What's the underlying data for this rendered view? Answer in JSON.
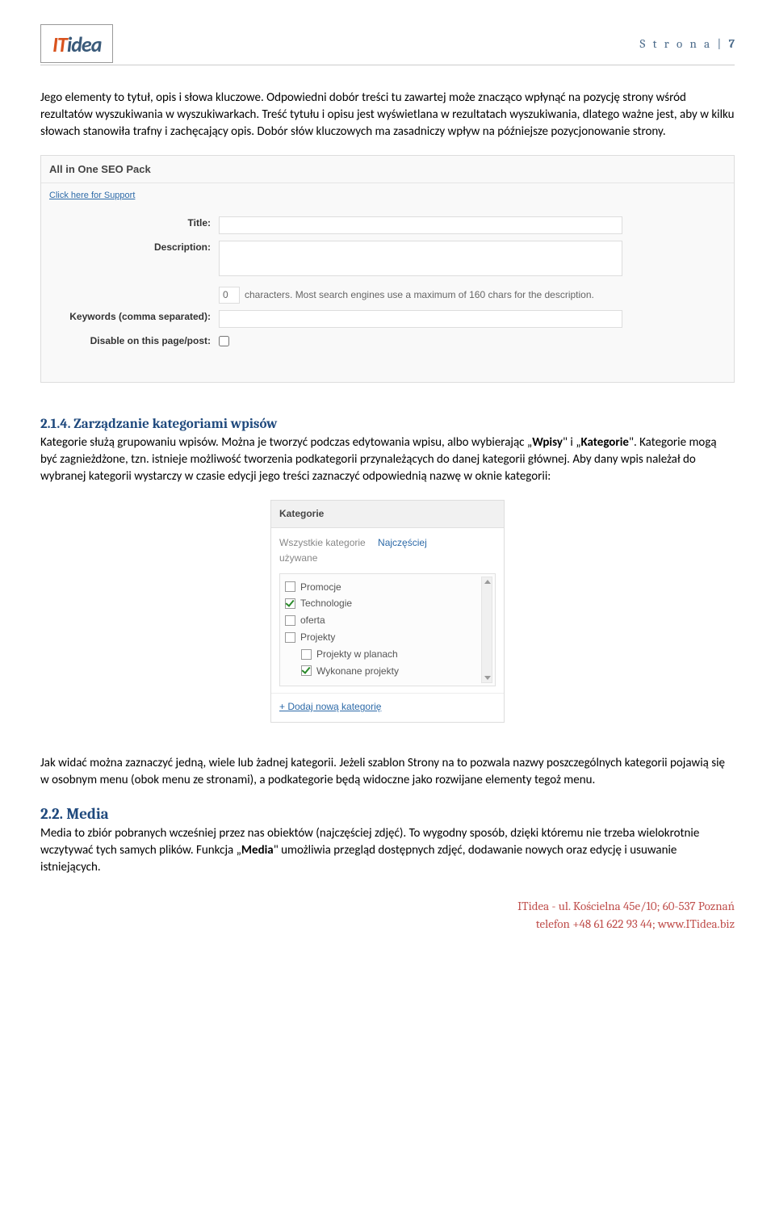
{
  "header": {
    "logo_it": "IT",
    "logo_idea": "idea",
    "page_label": "S t r o n a  | ",
    "page_no": "7"
  },
  "para1": "Jego elementy to tytuł, opis i słowa kluczowe. Odpowiedni dobór treści tu zawartej może znacząco wpłynąć na pozycję strony wśród rezultatów wyszukiwania w wyszukiwarkach. Treść tytułu i opisu jest wyświetlana w rezultatach wyszukiwania, dlatego ważne jest, aby w kilku słowach stanowiła trafny i zachęcający opis. Dobór słów kluczowych ma zasadniczy wpływ na późniejsze pozycjonowanie strony.",
  "seo": {
    "panel_title": "All in One SEO Pack",
    "support_link": "Click here for Support",
    "title_label": "Title:",
    "desc_label": "Description:",
    "char_count": "0",
    "char_hint": "characters. Most search engines use a maximum of 160 chars for the description.",
    "keywords_label": "Keywords (comma separated):",
    "disable_label": "Disable on this page/post:"
  },
  "h214_no": "2.1.4. ",
  "h214_title": "Zarządzanie kategoriami wpisów",
  "para2a": "Kategorie służą grupowaniu wpisów. Można je tworzyć podczas edytowania wpisu, albo wybierając „",
  "para2_wpisy": "Wpisy",
  "para2b": "\" i „",
  "para2_kategorie": "Kategorie",
  "para2c": "\". Kategorie mogą być zagnieżdżone, tzn. istnieje możliwość tworzenia podkategorii przynależących do danej kategorii głównej. Aby dany wpis należał do wybranej kategorii wystarczy w czasie edycji jego treści zaznaczyć odpowiednią nazwę w oknie kategorii:",
  "categories": {
    "panel_title": "Kategorie",
    "tab_all": "Wszystkie kategorie",
    "tab_freq": "Najczęściej",
    "tab_freq2": "używane",
    "items": [
      {
        "label": "Promocje",
        "checked": false,
        "indent": false
      },
      {
        "label": "Technologie",
        "checked": true,
        "indent": false
      },
      {
        "label": "oferta",
        "checked": false,
        "indent": false
      },
      {
        "label": "Projekty",
        "checked": false,
        "indent": false
      },
      {
        "label": "Projekty w planach",
        "checked": false,
        "indent": true
      },
      {
        "label": "Wykonane projekty",
        "checked": true,
        "indent": true
      }
    ],
    "add_link": "+ Dodaj nową kategorię"
  },
  "para3": "Jak widać można zaznaczyć jedną, wiele lub żadnej kategorii. Jeżeli szablon Strony na to pozwala nazwy poszczególnych kategorii pojawią się w osobnym menu (obok menu ze stronami), a podkategorie będą widoczne jako rozwijane elementy tegoż menu.",
  "h22_no": "2.2. ",
  "h22_title": "Media",
  "para4a": "Media to zbiór pobranych wcześniej przez nas obiektów (najczęściej zdjęć). To wygodny sposób, dzięki któremu nie trzeba wielokrotnie wczytywać tych samych plików. Funkcja „",
  "para4_media": "Media",
  "para4b": "\" umożliwia przegląd dostępnych zdjęć, dodawanie nowych oraz edycję i usuwanie istniejących.",
  "footer": {
    "line1": "ITidea - ul. Kościelna 45e/10;  60-537 Poznań",
    "line2": "telefon +48 61 622 93 44; www.ITidea.biz"
  }
}
